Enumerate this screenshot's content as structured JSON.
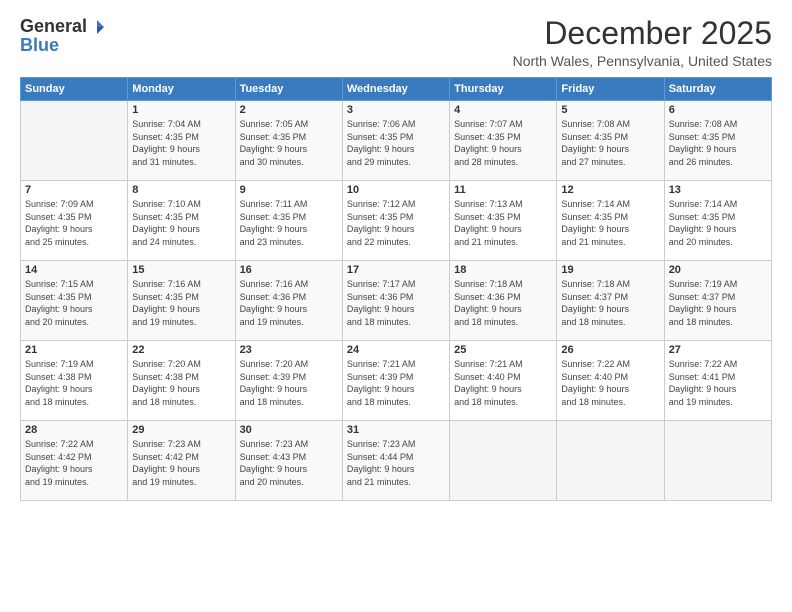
{
  "logo": {
    "general": "General",
    "blue": "Blue"
  },
  "title": "December 2025",
  "location": "North Wales, Pennsylvania, United States",
  "days_header": [
    "Sunday",
    "Monday",
    "Tuesday",
    "Wednesday",
    "Thursday",
    "Friday",
    "Saturday"
  ],
  "weeks": [
    [
      {
        "day": "",
        "info": ""
      },
      {
        "day": "1",
        "info": "Sunrise: 7:04 AM\nSunset: 4:35 PM\nDaylight: 9 hours\nand 31 minutes."
      },
      {
        "day": "2",
        "info": "Sunrise: 7:05 AM\nSunset: 4:35 PM\nDaylight: 9 hours\nand 30 minutes."
      },
      {
        "day": "3",
        "info": "Sunrise: 7:06 AM\nSunset: 4:35 PM\nDaylight: 9 hours\nand 29 minutes."
      },
      {
        "day": "4",
        "info": "Sunrise: 7:07 AM\nSunset: 4:35 PM\nDaylight: 9 hours\nand 28 minutes."
      },
      {
        "day": "5",
        "info": "Sunrise: 7:08 AM\nSunset: 4:35 PM\nDaylight: 9 hours\nand 27 minutes."
      },
      {
        "day": "6",
        "info": "Sunrise: 7:08 AM\nSunset: 4:35 PM\nDaylight: 9 hours\nand 26 minutes."
      }
    ],
    [
      {
        "day": "7",
        "info": "Sunrise: 7:09 AM\nSunset: 4:35 PM\nDaylight: 9 hours\nand 25 minutes."
      },
      {
        "day": "8",
        "info": "Sunrise: 7:10 AM\nSunset: 4:35 PM\nDaylight: 9 hours\nand 24 minutes."
      },
      {
        "day": "9",
        "info": "Sunrise: 7:11 AM\nSunset: 4:35 PM\nDaylight: 9 hours\nand 23 minutes."
      },
      {
        "day": "10",
        "info": "Sunrise: 7:12 AM\nSunset: 4:35 PM\nDaylight: 9 hours\nand 22 minutes."
      },
      {
        "day": "11",
        "info": "Sunrise: 7:13 AM\nSunset: 4:35 PM\nDaylight: 9 hours\nand 21 minutes."
      },
      {
        "day": "12",
        "info": "Sunrise: 7:14 AM\nSunset: 4:35 PM\nDaylight: 9 hours\nand 21 minutes."
      },
      {
        "day": "13",
        "info": "Sunrise: 7:14 AM\nSunset: 4:35 PM\nDaylight: 9 hours\nand 20 minutes."
      }
    ],
    [
      {
        "day": "14",
        "info": "Sunrise: 7:15 AM\nSunset: 4:35 PM\nDaylight: 9 hours\nand 20 minutes."
      },
      {
        "day": "15",
        "info": "Sunrise: 7:16 AM\nSunset: 4:35 PM\nDaylight: 9 hours\nand 19 minutes."
      },
      {
        "day": "16",
        "info": "Sunrise: 7:16 AM\nSunset: 4:36 PM\nDaylight: 9 hours\nand 19 minutes."
      },
      {
        "day": "17",
        "info": "Sunrise: 7:17 AM\nSunset: 4:36 PM\nDaylight: 9 hours\nand 18 minutes."
      },
      {
        "day": "18",
        "info": "Sunrise: 7:18 AM\nSunset: 4:36 PM\nDaylight: 9 hours\nand 18 minutes."
      },
      {
        "day": "19",
        "info": "Sunrise: 7:18 AM\nSunset: 4:37 PM\nDaylight: 9 hours\nand 18 minutes."
      },
      {
        "day": "20",
        "info": "Sunrise: 7:19 AM\nSunset: 4:37 PM\nDaylight: 9 hours\nand 18 minutes."
      }
    ],
    [
      {
        "day": "21",
        "info": "Sunrise: 7:19 AM\nSunset: 4:38 PM\nDaylight: 9 hours\nand 18 minutes."
      },
      {
        "day": "22",
        "info": "Sunrise: 7:20 AM\nSunset: 4:38 PM\nDaylight: 9 hours\nand 18 minutes."
      },
      {
        "day": "23",
        "info": "Sunrise: 7:20 AM\nSunset: 4:39 PM\nDaylight: 9 hours\nand 18 minutes."
      },
      {
        "day": "24",
        "info": "Sunrise: 7:21 AM\nSunset: 4:39 PM\nDaylight: 9 hours\nand 18 minutes."
      },
      {
        "day": "25",
        "info": "Sunrise: 7:21 AM\nSunset: 4:40 PM\nDaylight: 9 hours\nand 18 minutes."
      },
      {
        "day": "26",
        "info": "Sunrise: 7:22 AM\nSunset: 4:40 PM\nDaylight: 9 hours\nand 18 minutes."
      },
      {
        "day": "27",
        "info": "Sunrise: 7:22 AM\nSunset: 4:41 PM\nDaylight: 9 hours\nand 19 minutes."
      }
    ],
    [
      {
        "day": "28",
        "info": "Sunrise: 7:22 AM\nSunset: 4:42 PM\nDaylight: 9 hours\nand 19 minutes."
      },
      {
        "day": "29",
        "info": "Sunrise: 7:23 AM\nSunset: 4:42 PM\nDaylight: 9 hours\nand 19 minutes."
      },
      {
        "day": "30",
        "info": "Sunrise: 7:23 AM\nSunset: 4:43 PM\nDaylight: 9 hours\nand 20 minutes."
      },
      {
        "day": "31",
        "info": "Sunrise: 7:23 AM\nSunset: 4:44 PM\nDaylight: 9 hours\nand 21 minutes."
      },
      {
        "day": "",
        "info": ""
      },
      {
        "day": "",
        "info": ""
      },
      {
        "day": "",
        "info": ""
      }
    ]
  ]
}
